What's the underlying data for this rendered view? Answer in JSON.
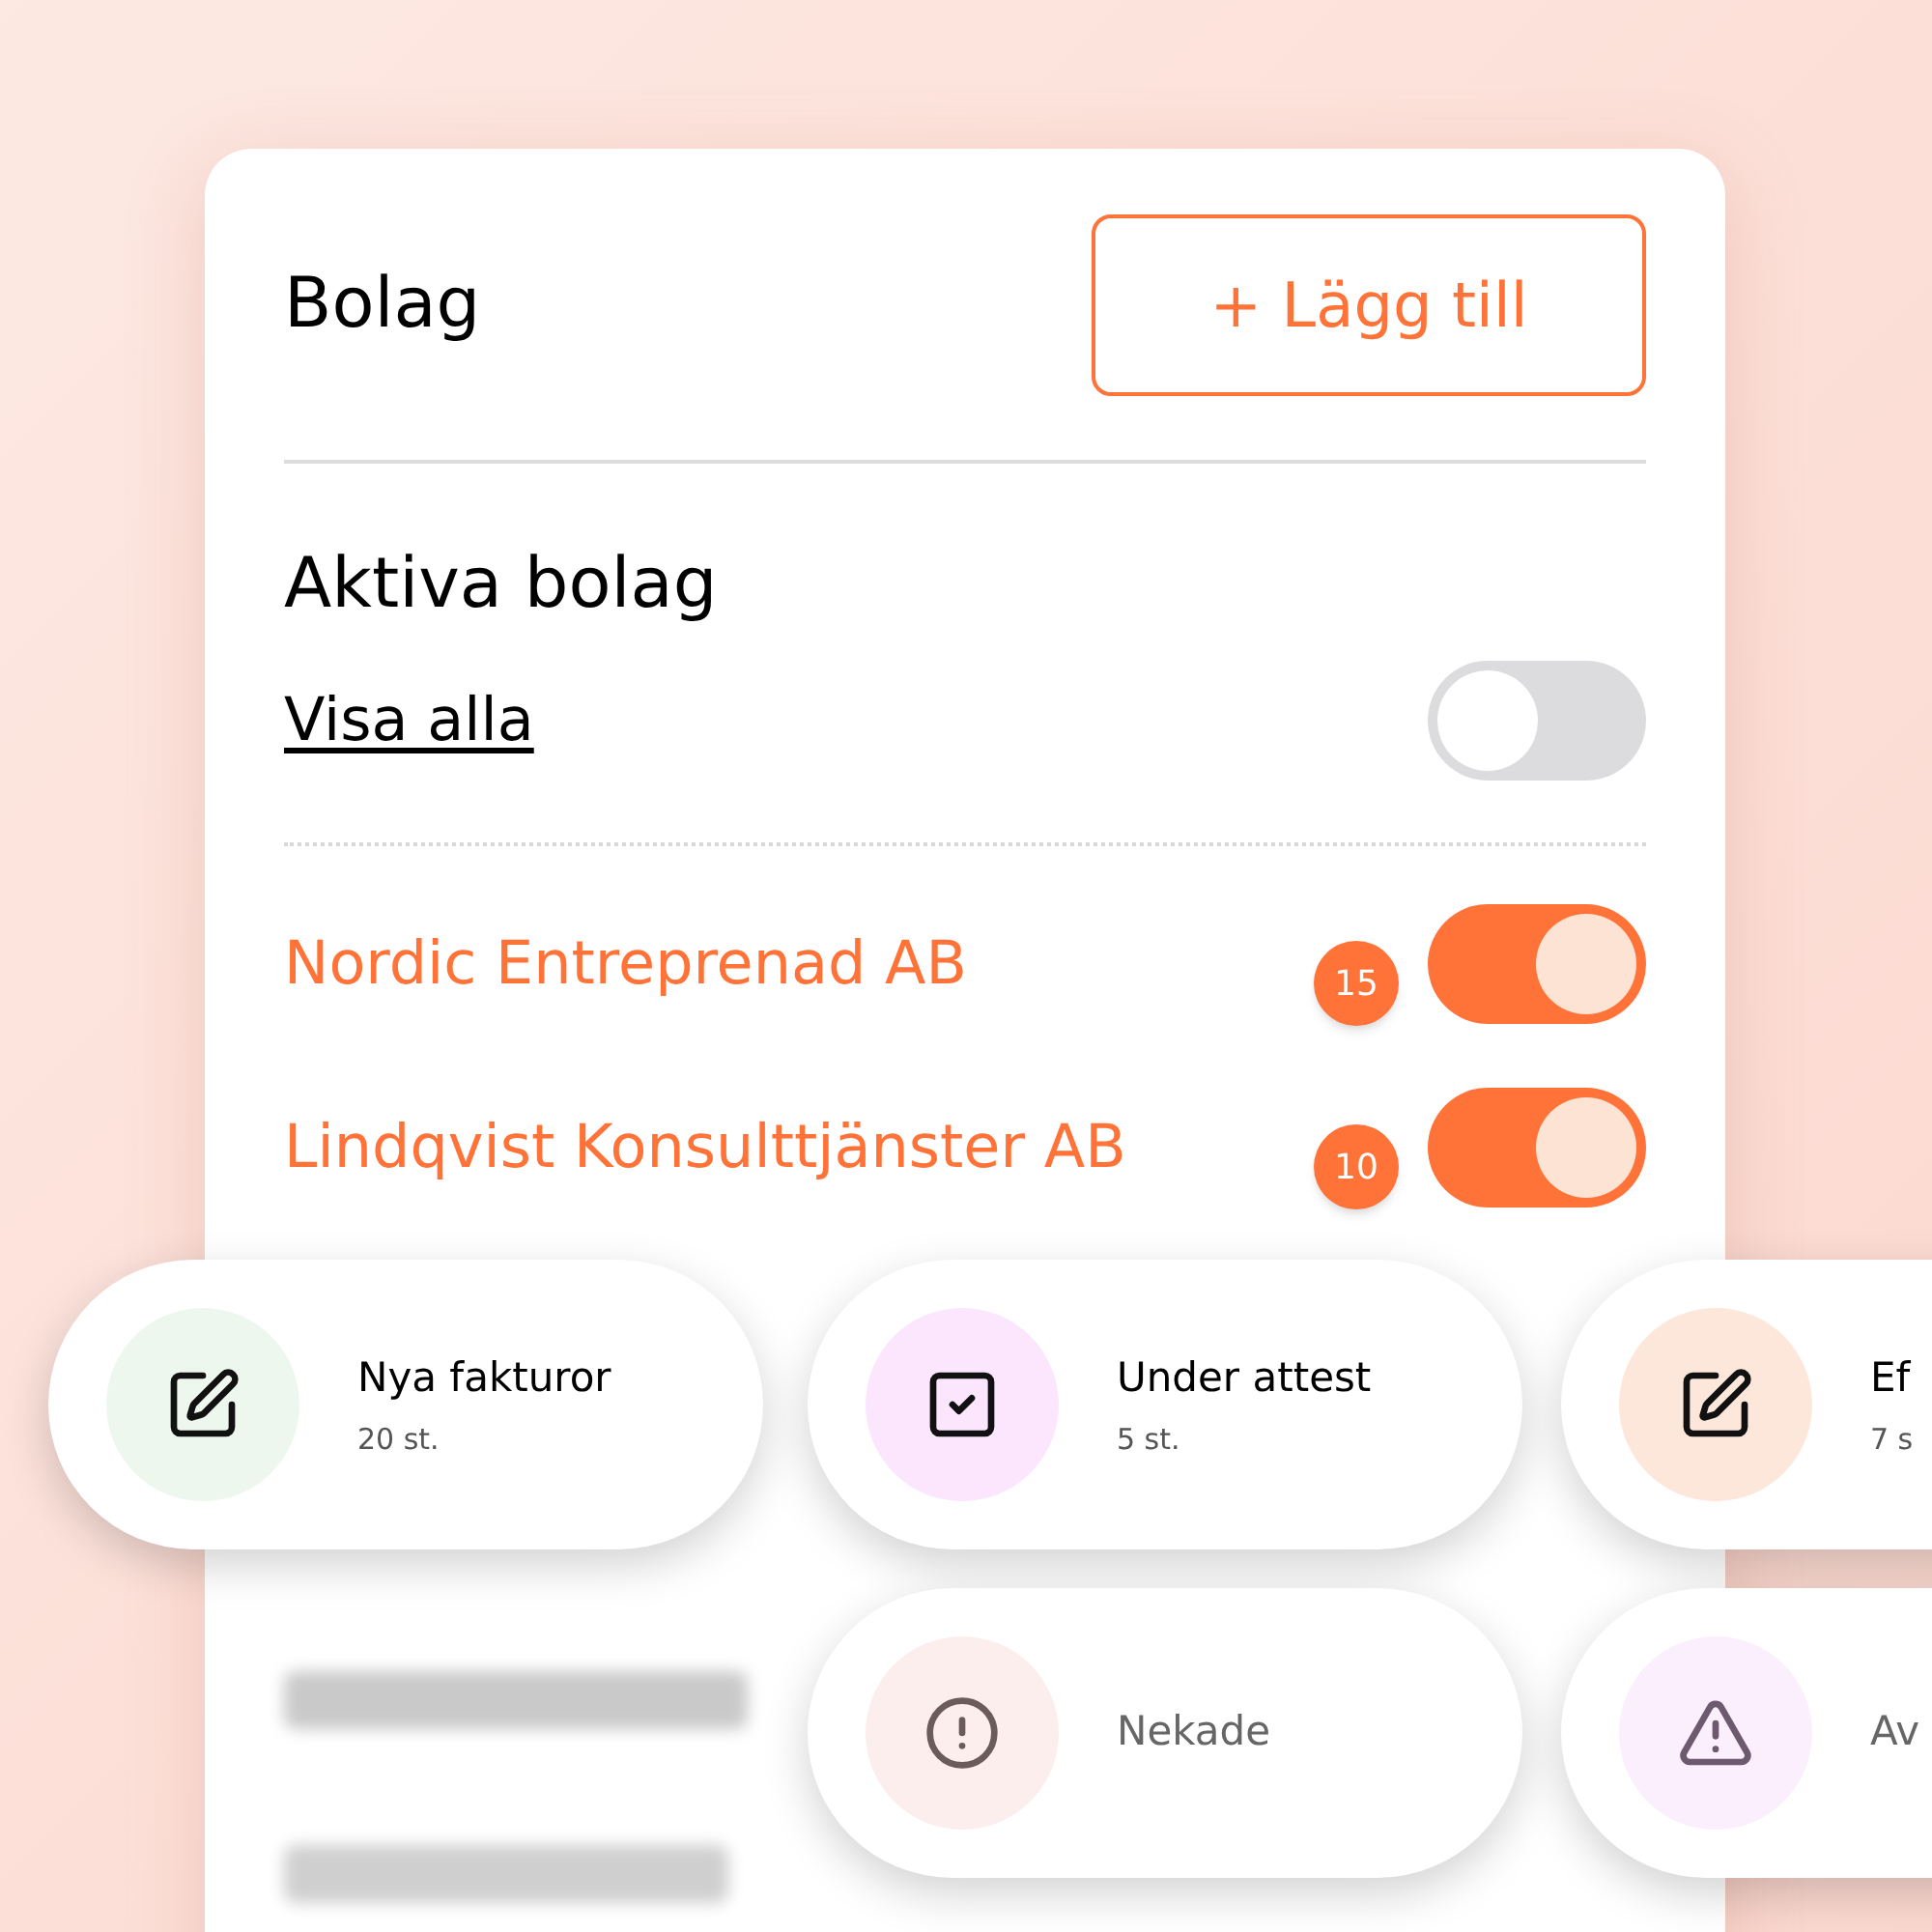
{
  "header": {
    "title": "Bolag",
    "add_button": "+ Lägg till"
  },
  "section": {
    "title": "Aktiva bolag",
    "show_all": {
      "label": "Visa alla",
      "on": false
    }
  },
  "companies": [
    {
      "name": "Nordic Entreprenad AB",
      "count": "15",
      "on": true
    },
    {
      "name": "Lindqvist Konsulttjänster AB",
      "count": "10",
      "on": true
    }
  ],
  "status_pills": [
    {
      "label": "Nya fakturor",
      "count": "20 st.",
      "kind": "edit",
      "color": "#edf7ee"
    },
    {
      "label": "Under attest",
      "count": "5 st.",
      "kind": "check",
      "color": "#fbe6fd"
    },
    {
      "label": "Ef",
      "count": "7 s",
      "kind": "edit",
      "color": "#fde6da"
    },
    {
      "label": "Nekade",
      "kind": "alert",
      "color": "#fdeeee"
    },
    {
      "label": "Av",
      "kind": "warning",
      "color": "#fbeefd"
    }
  ]
}
